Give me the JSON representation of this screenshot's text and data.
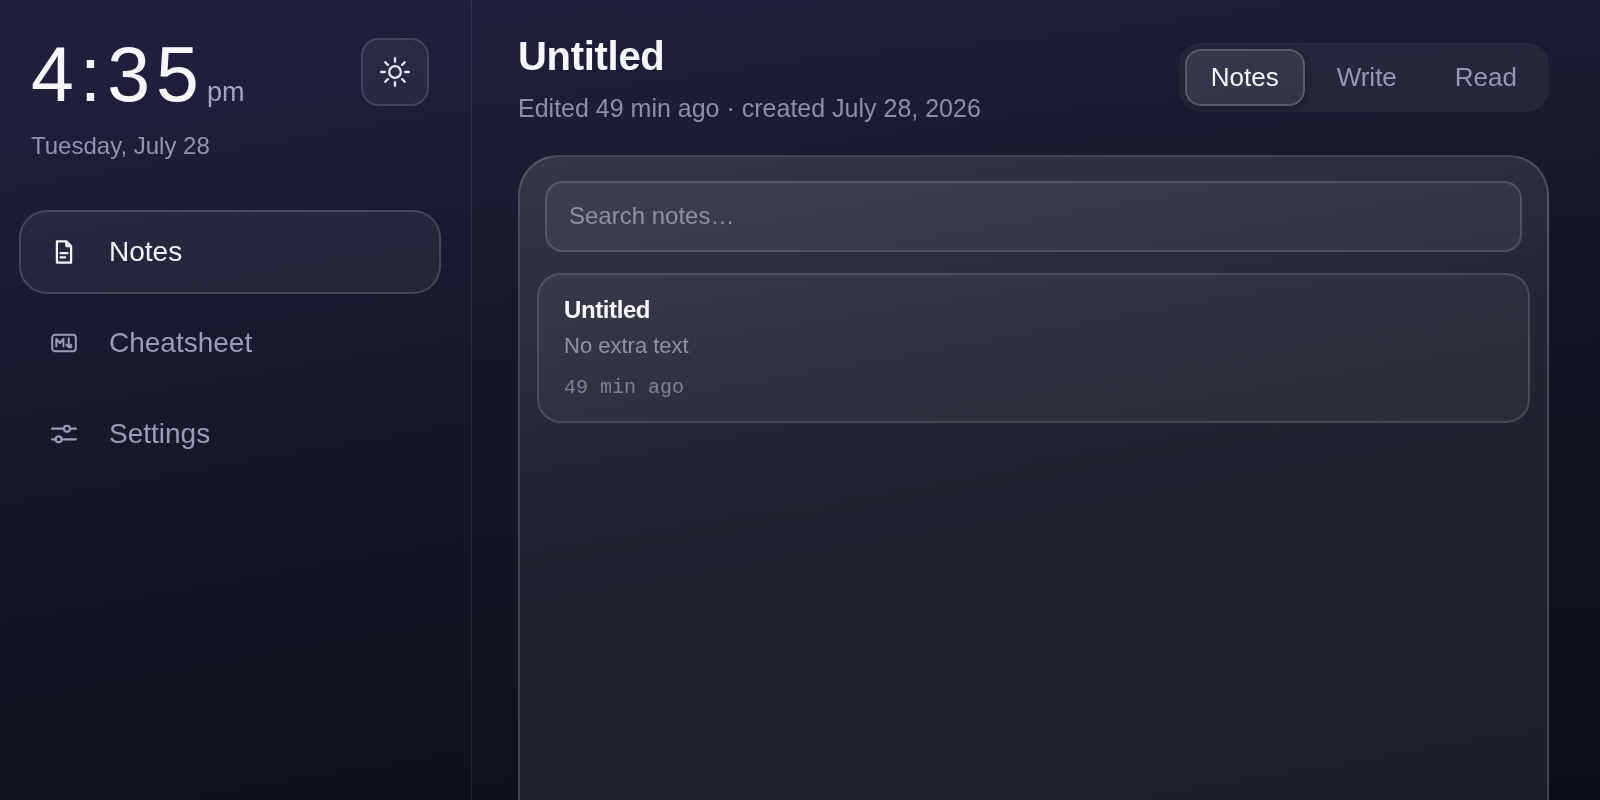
{
  "clock": {
    "time": "4:35",
    "meridiem": "pm",
    "date": "Tuesday, July 28"
  },
  "sidebar": {
    "items": [
      {
        "label": "Notes",
        "selected": true
      },
      {
        "label": "Cheatsheet",
        "selected": false
      },
      {
        "label": "Settings",
        "selected": false
      }
    ]
  },
  "note": {
    "title": "Untitled",
    "meta": "Edited 49 min ago · created July 28, 2026"
  },
  "view_tabs": [
    {
      "label": "Notes",
      "selected": true
    },
    {
      "label": "Write",
      "selected": false
    },
    {
      "label": "Read",
      "selected": false
    }
  ],
  "search": {
    "placeholder": "Search notes…"
  },
  "notes_list": [
    {
      "title": "Untitled",
      "preview": "No extra text",
      "time": "49 min ago"
    }
  ]
}
